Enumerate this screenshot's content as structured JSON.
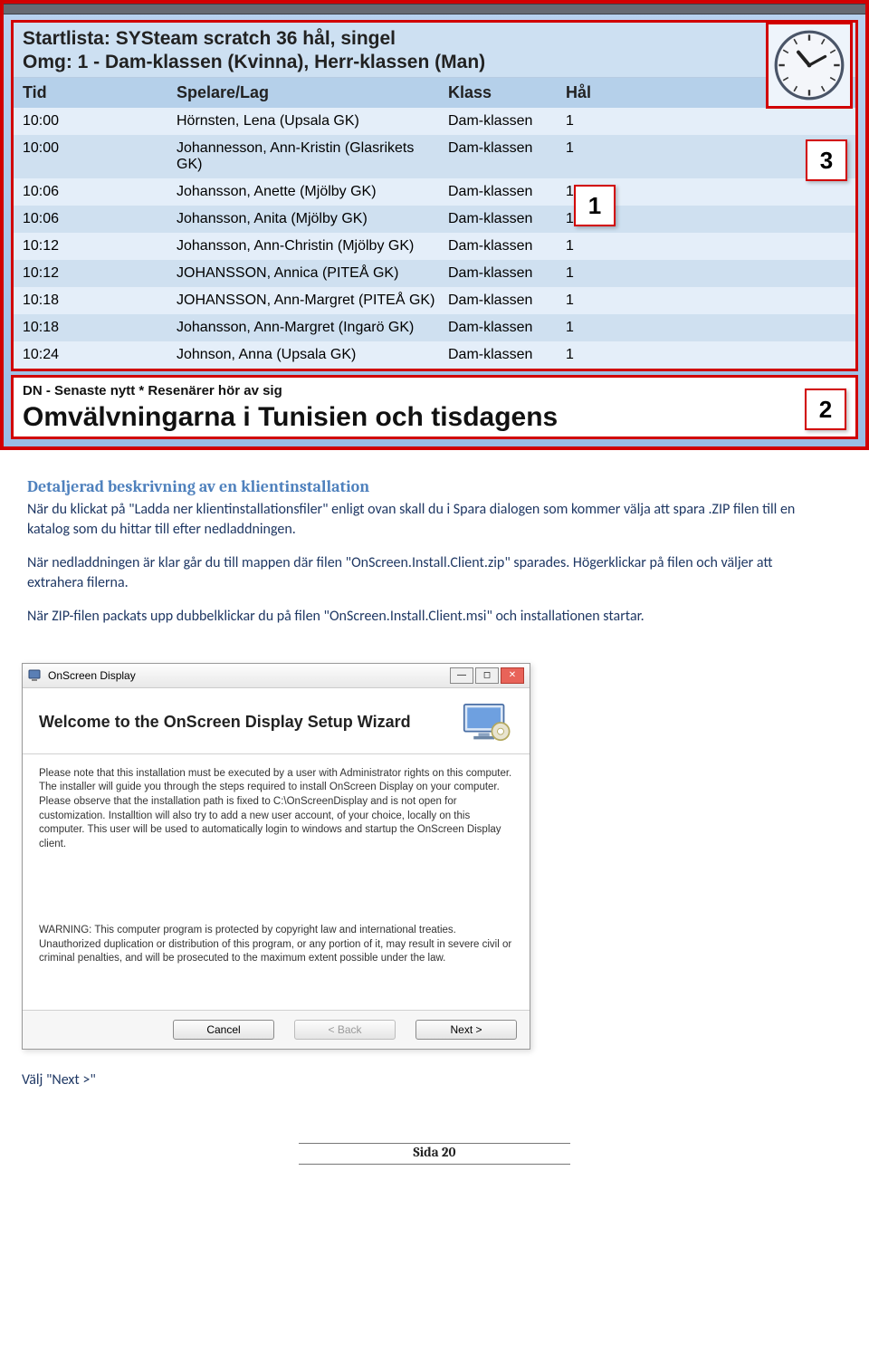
{
  "screenshot1": {
    "header_line1": "Startlista: SYSteam scratch 36 hål, singel",
    "header_line2": "Omg: 1 - Dam-klassen (Kvinna), Herr-klassen (Man)",
    "columns": {
      "tid": "Tid",
      "spelare": "Spelare/Lag",
      "klass": "Klass",
      "hal": "Hål"
    },
    "rows": [
      {
        "tid": "10:00",
        "spelare": "Hörnsten, Lena (Upsala GK)",
        "klass": "Dam-klassen",
        "hal": "1"
      },
      {
        "tid": "10:00",
        "spelare": "Johannesson, Ann-Kristin (Glasrikets GK)",
        "klass": "Dam-klassen",
        "hal": "1"
      },
      {
        "tid": "10:06",
        "spelare": "Johansson, Anette (Mjölby GK)",
        "klass": "Dam-klassen",
        "hal": "1"
      },
      {
        "tid": "10:06",
        "spelare": "Johansson, Anita (Mjölby GK)",
        "klass": "Dam-klassen",
        "hal": "1"
      },
      {
        "tid": "10:12",
        "spelare": "Johansson, Ann-Christin (Mjölby GK)",
        "klass": "Dam-klassen",
        "hal": "1"
      },
      {
        "tid": "10:12",
        "spelare": "JOHANSSON, Annica (PITEÅ GK)",
        "klass": "Dam-klassen",
        "hal": "1"
      },
      {
        "tid": "10:18",
        "spelare": "JOHANSSON, Ann-Margret (PITEÅ GK)",
        "klass": "Dam-klassen",
        "hal": "1"
      },
      {
        "tid": "10:18",
        "spelare": "Johansson, Ann-Margret (Ingarö GK)",
        "klass": "Dam-klassen",
        "hal": "1"
      },
      {
        "tid": "10:24",
        "spelare": "Johnson, Anna (Upsala GK)",
        "klass": "Dam-klassen",
        "hal": "1"
      }
    ],
    "callouts": {
      "c1": "1",
      "c2": "2",
      "c3": "3"
    },
    "ticker_top": "DN - Senaste nytt * Resenärer hör av sig",
    "ticker_headline": "Omvälvningarna i Tunisien och tisdagens"
  },
  "article": {
    "heading": "Detaljerad beskrivning av en klientinstallation",
    "p1": "När du klickat på \"Ladda ner klientinstallationsfiler\" enligt ovan skall du i Spara dialogen som kommer välja att spara .ZIP filen till en katalog som du hittar till efter nedladdningen.",
    "p2": "När nedladdningen är klar går du till mappen där filen \"OnScreen.Install.Client.zip\" sparades. Högerklickar på filen och väljer att extrahera filerna.",
    "p3": "När ZIP-filen packats upp dubbelklickar du på filen \"OnScreen.Install.Client.msi\" och installationen startar.",
    "after_installer": "Välj \"Next >\""
  },
  "installer": {
    "window_title": "OnScreen Display",
    "heading": "Welcome to the OnScreen Display Setup Wizard",
    "body1": "Please note that this installation must be executed by a user with Administrator rights on this computer. The installer will guide you through the steps required to install OnScreen Display on your computer. Please observe that the installation path is fixed to C:\\OnScreenDisplay and is not open for customization. Installtion will also try to add a new user account, of your choice, locally on this computer. This user will be used to automatically login to windows and startup the OnScreen Display client.",
    "body2": "WARNING: This computer program is protected by copyright law and international treaties. Unauthorized duplication or distribution of this program, or any portion of it, may result in severe civil or criminal penalties, and will be prosecuted to the maximum extent possible under the law.",
    "buttons": {
      "cancel": "Cancel",
      "back": "< Back",
      "next": "Next >"
    }
  },
  "footer": "Sida 20"
}
